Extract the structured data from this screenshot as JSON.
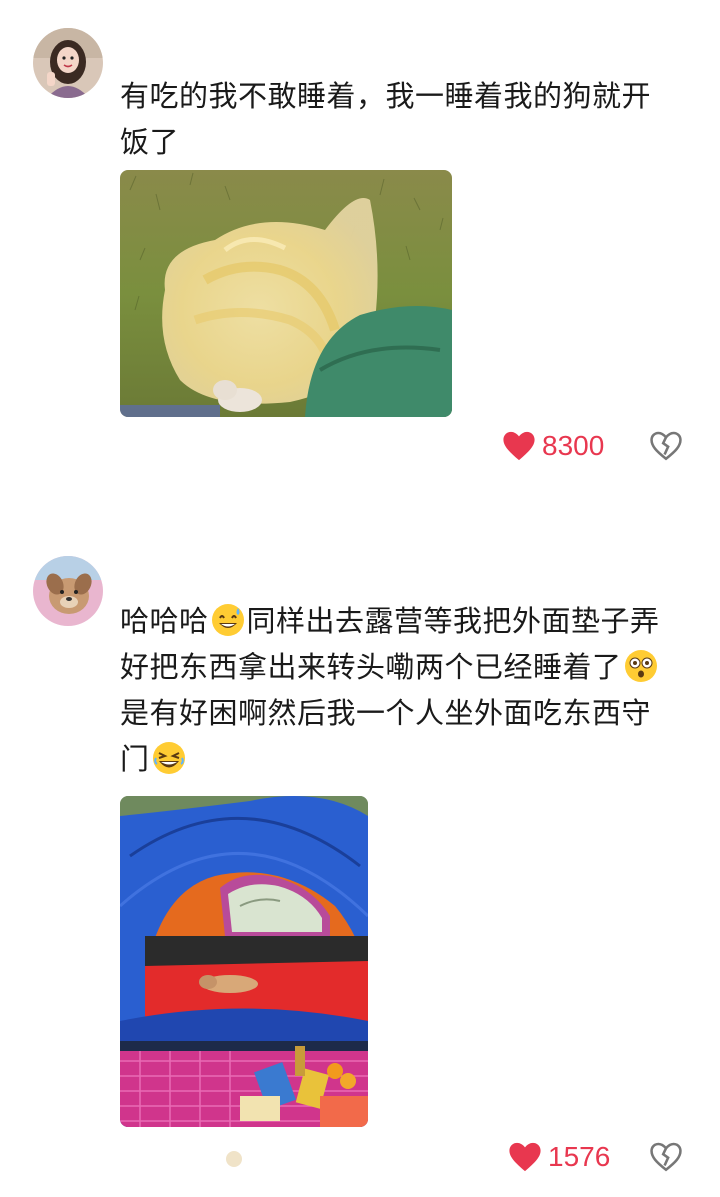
{
  "comments": [
    {
      "text_line1": "有吃的我不敢睡着，我一睡着我的狗就开",
      "text_line2": "饭了",
      "likes": "8300",
      "avatar_icon": "girl-avatar",
      "photo": "plastic-bag-on-grass-photo"
    },
    {
      "text_seg1": "哈哈哈",
      "text_seg2": "同样出去露营等我把外面垫子弄",
      "text_line2": "好把东西拿出来转头嘞两个已经睡着了",
      "text_line3": "是有好困啊然后我一个人坐外面吃东西守",
      "text_line4": "门",
      "likes": "1576",
      "avatar_icon": "dog-avatar",
      "photo": "tent-with-sleeping-dog-photo"
    }
  ],
  "colors": {
    "like_red": "#e8374f",
    "text": "#1a1a1a",
    "dislike_gray": "#777777"
  }
}
